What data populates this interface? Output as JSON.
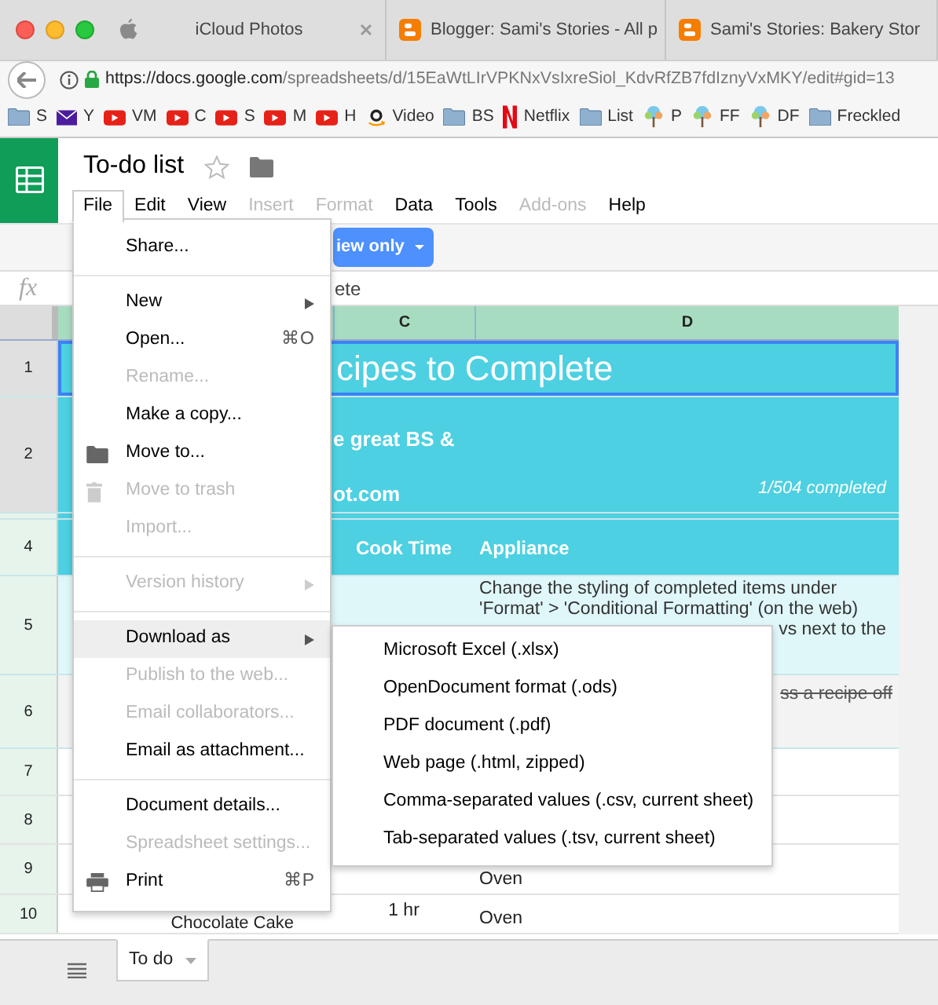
{
  "browser": {
    "tabs": [
      {
        "title": "iCloud Photos",
        "kind": "apple",
        "selected": false
      },
      {
        "title": "Blogger: Sami's Stories - All p",
        "kind": "blogger",
        "selected": false
      },
      {
        "title": "Sami's Stories: Bakery Stor",
        "kind": "blogger",
        "selected": false
      }
    ],
    "url_host": "https://docs.google.com",
    "url_path": "/spreadsheets/d/15EaWtLIrVPKNxVsIxreSiol_KdvRfZB7fdIznyVxMKY/edit#gid=13",
    "bookmarks": [
      {
        "label": "S",
        "kind": "folder"
      },
      {
        "label": "Y",
        "kind": "mail"
      },
      {
        "label": "VM",
        "kind": "video"
      },
      {
        "label": "C",
        "kind": "video"
      },
      {
        "label": "S",
        "kind": "video"
      },
      {
        "label": "M",
        "kind": "video"
      },
      {
        "label": "H",
        "kind": "video"
      },
      {
        "label": "Video",
        "kind": "amazon"
      },
      {
        "label": "BS",
        "kind": "folder"
      },
      {
        "label": "Netflix",
        "kind": "netflix"
      },
      {
        "label": "List",
        "kind": "folder"
      },
      {
        "label": "P",
        "kind": "tree"
      },
      {
        "label": "FF",
        "kind": "tree"
      },
      {
        "label": "DF",
        "kind": "tree"
      },
      {
        "label": "Freckled",
        "kind": "folder"
      }
    ]
  },
  "sheet": {
    "title": "To-do list",
    "menus": [
      {
        "label": "File",
        "disabled": false,
        "selected": true
      },
      {
        "label": "Edit",
        "disabled": false,
        "selected": false
      },
      {
        "label": "View",
        "disabled": false,
        "selected": false
      },
      {
        "label": "Insert",
        "disabled": true,
        "selected": false
      },
      {
        "label": "Format",
        "disabled": true,
        "selected": false
      },
      {
        "label": "Data",
        "disabled": false,
        "selected": false
      },
      {
        "label": "Tools",
        "disabled": false,
        "selected": false
      },
      {
        "label": "Add-ons",
        "disabled": true,
        "selected": false
      },
      {
        "label": "Help",
        "disabled": false,
        "selected": false
      }
    ],
    "view_button": "iew only",
    "fx_label": "fx",
    "formula_text": "ete",
    "columns": [
      "C",
      "D"
    ],
    "rows": [
      {
        "number": "1",
        "kind": "title",
        "c": "cipes to Complete"
      },
      {
        "number": "2",
        "kind": "subtitle",
        "c": "e great BS &",
        "c2": "ot.com",
        "d": "1/504 completed"
      },
      {
        "kind": "spacer"
      },
      {
        "number": "4",
        "kind": "header",
        "c": "Cook Time",
        "d": "Appliance"
      },
      {
        "number": "5",
        "kind": "note",
        "d": "Change the styling of completed items under",
        "d2": "'Format' > 'Conditional Formatting' (on the web)",
        "d3": "vs next to the"
      },
      {
        "number": "6",
        "kind": "done",
        "d": "ss a recipe off"
      },
      {
        "number": "7",
        "kind": "plain"
      },
      {
        "number": "8",
        "kind": "plain"
      },
      {
        "number": "9",
        "kind": "plain",
        "d": "Oven"
      },
      {
        "number": "10",
        "kind": "plain",
        "b": "Chocolate Cake",
        "c": "1 hr",
        "d": "Oven"
      }
    ],
    "sheet_tabs": [
      {
        "label": "To do",
        "selected": true
      }
    ]
  },
  "file_menu": [
    {
      "kind": "item",
      "label": "Share...",
      "disabled": false,
      "highlighted": false,
      "submenu": false
    },
    {
      "kind": "divider"
    },
    {
      "kind": "item",
      "label": "New",
      "submenu": true,
      "disabled": false,
      "highlighted": false
    },
    {
      "kind": "item",
      "label": "Open...",
      "shortcut": "⌘O",
      "disabled": false,
      "highlighted": false,
      "submenu": false
    },
    {
      "kind": "item",
      "label": "Rename...",
      "disabled": true,
      "highlighted": false,
      "submenu": false
    },
    {
      "kind": "item",
      "label": "Make a copy...",
      "disabled": false,
      "highlighted": false,
      "submenu": false
    },
    {
      "kind": "folder",
      "label": "Move to...",
      "disabled": false,
      "highlighted": false,
      "submenu": false
    },
    {
      "kind": "trash",
      "label": "Move to trash",
      "disabled": true,
      "highlighted": false,
      "submenu": false
    },
    {
      "kind": "item",
      "label": "Import...",
      "disabled": true,
      "highlighted": false,
      "submenu": false
    },
    {
      "kind": "divider"
    },
    {
      "kind": "item",
      "label": "Version history",
      "submenu": true,
      "disabled": true,
      "highlighted": false
    },
    {
      "kind": "divider"
    },
    {
      "kind": "item",
      "label": "Download as",
      "submenu": true,
      "disabled": false,
      "highlighted": true
    },
    {
      "kind": "item",
      "label": "Publish to the web...",
      "disabled": true,
      "highlighted": false,
      "submenu": false
    },
    {
      "kind": "item",
      "label": "Email collaborators...",
      "disabled": true,
      "highlighted": false,
      "submenu": false
    },
    {
      "kind": "item",
      "label": "Email as attachment...",
      "disabled": false,
      "highlighted": false,
      "submenu": false
    },
    {
      "kind": "divider"
    },
    {
      "kind": "item",
      "label": "Document details...",
      "disabled": false,
      "highlighted": false,
      "submenu": false
    },
    {
      "kind": "item",
      "label": "Spreadsheet settings...",
      "disabled": true,
      "highlighted": false,
      "submenu": false
    },
    {
      "kind": "print",
      "label": "Print",
      "shortcut": "⌘P",
      "disabled": false,
      "highlighted": false,
      "submenu": false
    }
  ],
  "download_submenu": [
    "Microsoft Excel (.xlsx)",
    "OpenDocument format (.ods)",
    "PDF document (.pdf)",
    "Web page (.html, zipped)",
    "Comma-separated values (.csv, current sheet)",
    "Tab-separated values (.tsv, current sheet)"
  ]
}
